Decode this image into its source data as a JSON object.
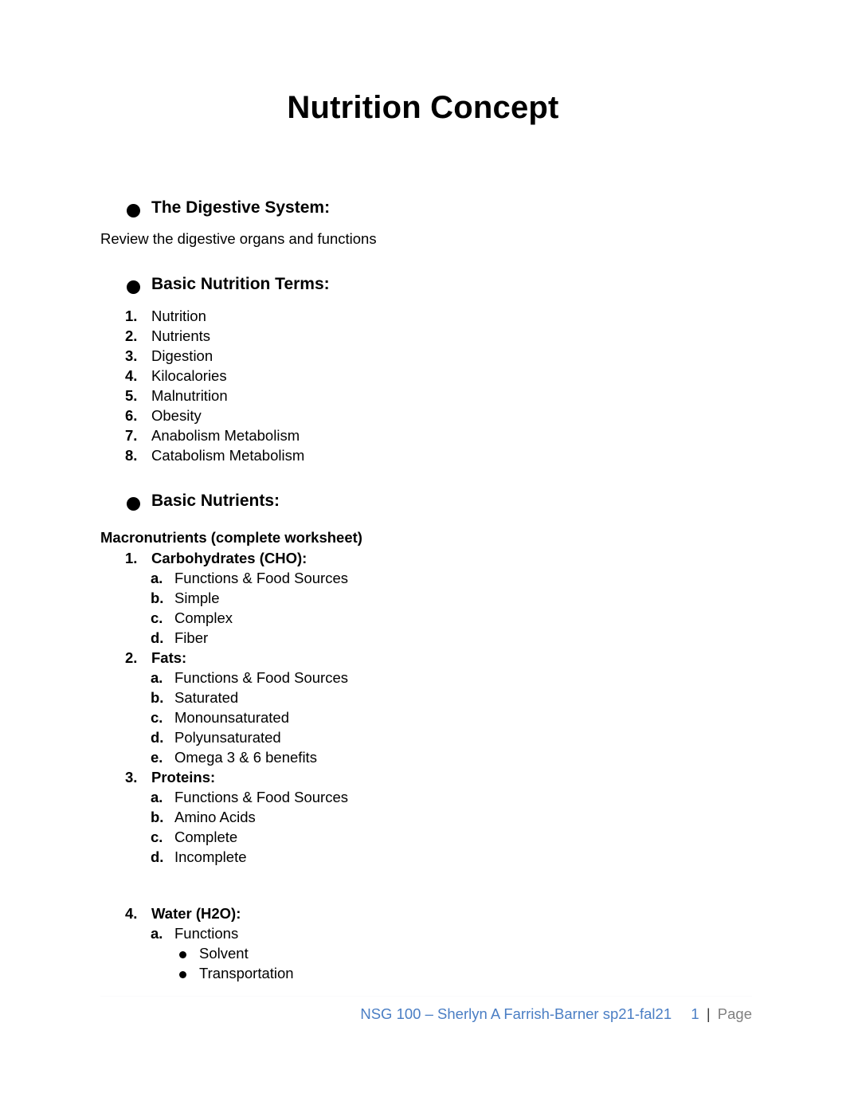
{
  "document": {
    "title": "Nutrition Concept"
  },
  "sections": [
    {
      "heading": "The Digestive System:",
      "intro": "Review the digestive organs and functions"
    },
    {
      "heading": "Basic Nutrition Terms:",
      "terms": [
        {
          "marker": "1.",
          "text": "Nutrition"
        },
        {
          "marker": "2.",
          "text": "Nutrients"
        },
        {
          "marker": "3.",
          "text": "Digestion"
        },
        {
          "marker": "4.",
          "text": "Kilocalories"
        },
        {
          "marker": "5.",
          "text": "Malnutrition"
        },
        {
          "marker": "6.",
          "text": "Obesity"
        },
        {
          "marker": "7.",
          "text": "Anabolism Metabolism"
        },
        {
          "marker": "8.",
          "text": "Catabolism Metabolism"
        }
      ]
    },
    {
      "heading": "Basic Nutrients:",
      "subheading": "Macronutrients (complete worksheet)",
      "groups": [
        {
          "marker": "1.",
          "title": "Carbohydrates (CHO):",
          "items": [
            {
              "marker": "a.",
              "text": "Functions & Food Sources"
            },
            {
              "marker": "b.",
              "text": "Simple"
            },
            {
              "marker": "c.",
              "text": "Complex"
            },
            {
              "marker": "d.",
              "text": "Fiber"
            }
          ]
        },
        {
          "marker": "2.",
          "title": "Fats:",
          "items": [
            {
              "marker": "a.",
              "text": "Functions & Food Sources"
            },
            {
              "marker": "b.",
              "text": "Saturated"
            },
            {
              "marker": "c.",
              "text": "Monounsaturated"
            },
            {
              "marker": "d.",
              "text": "Polyunsaturated"
            },
            {
              "marker": "e.",
              "text": "Omega 3 & 6 benefits"
            }
          ]
        },
        {
          "marker": "3.",
          "title": "Proteins:",
          "items": [
            {
              "marker": "a.",
              "text": "Functions & Food Sources"
            },
            {
              "marker": "b.",
              "text": "Amino Acids"
            },
            {
              "marker": "c.",
              "text": "Complete"
            },
            {
              "marker": "d.",
              "text": "Incomplete"
            }
          ]
        },
        {
          "marker": "4.",
          "title": "Water (H2O):",
          "items": [
            {
              "marker": "a.",
              "text": "Functions"
            }
          ],
          "subitems": [
            {
              "text": "Solvent"
            },
            {
              "text": "Transportation"
            }
          ]
        }
      ]
    }
  ],
  "footer": {
    "course": "NSG 100 – Sherlyn A Farrish-Barner sp21-fal21",
    "page_number": "1",
    "separator": "|",
    "page_label": "Page",
    "link_color": "#4a7ec4",
    "label_color": "#808080"
  }
}
